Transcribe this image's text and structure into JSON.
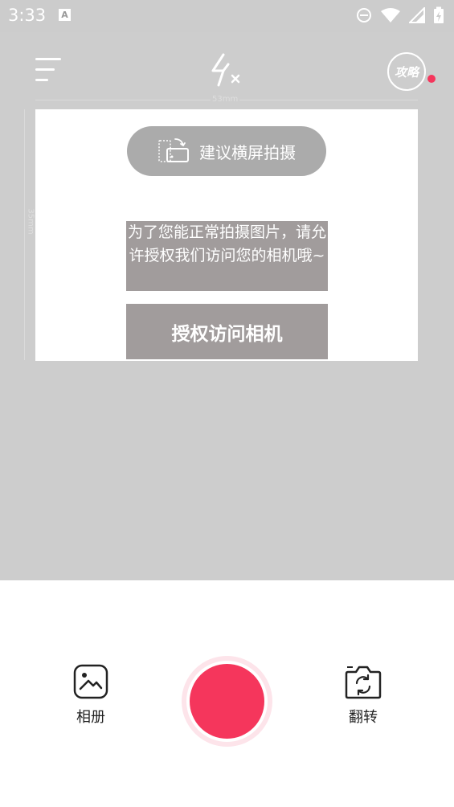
{
  "status_bar": {
    "time": "3:33",
    "notification_letter": "A"
  },
  "top_bar": {
    "guide_label": "攻略"
  },
  "ruler": {
    "width_label": "53mm",
    "height_label": "35mm"
  },
  "preview": {
    "landscape_hint": "建议横屏拍摄",
    "permission_message": "为了您能正常拍摄图片，请允许授权我们访问您的相机哦~",
    "permission_button": "授权访问相机"
  },
  "bottom": {
    "album_label": "相册",
    "flip_label": "翻转"
  },
  "colors": {
    "accent": "#f5365c",
    "overlay": "#cdcdcd",
    "permission_bg": "#a19c9c",
    "pill_bg": "#ababab"
  }
}
